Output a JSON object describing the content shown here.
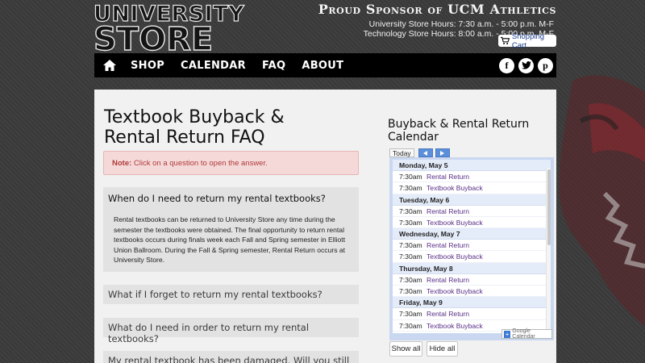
{
  "header": {
    "logo_line1": "UNIVERSITY",
    "logo_line2": "STORE",
    "sponsor": "Proud Sponsor of UCM Athletics",
    "hours_line1": "University Store Hours: 7:30 a.m. - 5:00 p.m. M-F",
    "hours_line2": "Technology Store Hours: 8:00 a.m. - 5:00 p.m. M-F",
    "cart_label": "Shopping Cart"
  },
  "nav": {
    "items": [
      "SHOP",
      "CALENDAR",
      "FAQ",
      "ABOUT"
    ],
    "social": [
      "f",
      "t",
      "p"
    ]
  },
  "main": {
    "title": "Textbook Buyback & Rental Return FAQ",
    "note_label": "Note:",
    "note_text": " Click on a question to open the answer.",
    "faq": [
      {
        "question": "When do I need to return my rental textbooks?",
        "answer": "Rental textbooks can be returned to University Store any time during the semester the textbooks were obtained. The final opportunity to return rental textbooks occurs during finals week each Fall and Spring semester in Elliott Union Ballroom. During the Fall & Spring semester, Rental Return occurs at University Store."
      },
      {
        "question": "What if I forget to return my rental textbooks?"
      },
      {
        "question": "What do I need in order to return my rental textbooks?"
      },
      {
        "question": "My rental textbook has been damaged. Will you still accept"
      }
    ]
  },
  "calendar": {
    "title": "Buyback & Rental Return Calendar",
    "today_label": "Today",
    "days": [
      {
        "label": "Monday, May 5",
        "events": [
          {
            "time": "7:30am",
            "name": "Rental Return"
          },
          {
            "time": "7:30am",
            "name": "Textbook Buyback"
          }
        ]
      },
      {
        "label": "Tuesday, May 6",
        "events": [
          {
            "time": "7:30am",
            "name": "Rental Return"
          },
          {
            "time": "7:30am",
            "name": "Textbook Buyback"
          }
        ]
      },
      {
        "label": "Wednesday, May 7",
        "events": [
          {
            "time": "7:30am",
            "name": "Rental Return"
          },
          {
            "time": "7:30am",
            "name": "Textbook Buyback"
          }
        ]
      },
      {
        "label": "Thursday, May 8",
        "events": [
          {
            "time": "7:30am",
            "name": "Rental Return"
          },
          {
            "time": "7:30am",
            "name": "Textbook Buyback"
          }
        ]
      },
      {
        "label": "Friday, May 9",
        "events": [
          {
            "time": "7:30am",
            "name": "Rental Return"
          },
          {
            "time": "7:30am",
            "name": "Textbook Buyback"
          }
        ]
      }
    ],
    "badge_label": "Google Calendar",
    "show_all": "Show all",
    "hide_all": "Hide all"
  },
  "colors": {
    "accent_red": "#c0202a",
    "nav_bg": "#000000",
    "link_purple": "#5a2f86",
    "cal_blue": "#5b8fd9"
  }
}
